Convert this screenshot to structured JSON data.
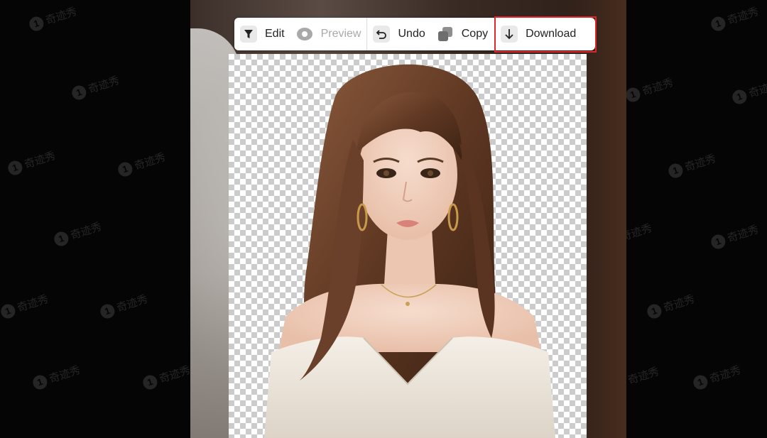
{
  "toolbar": {
    "edit_label": "Edit",
    "preview_label": "Preview",
    "undo_label": "Undo",
    "copy_label": "Copy",
    "download_label": "Download"
  },
  "icons": {
    "edit": "filter-icon",
    "preview": "eye-icon",
    "undo": "undo-icon",
    "copy": "copy-icon",
    "download": "download-arrow-icon"
  },
  "colors": {
    "highlight": "#e0262b",
    "checker_light": "#ffffff",
    "checker_dark": "#cbcbcb",
    "toolbar_bg": "#ffffff"
  },
  "watermark": {
    "text": "奇迹秀",
    "logo": "1"
  }
}
